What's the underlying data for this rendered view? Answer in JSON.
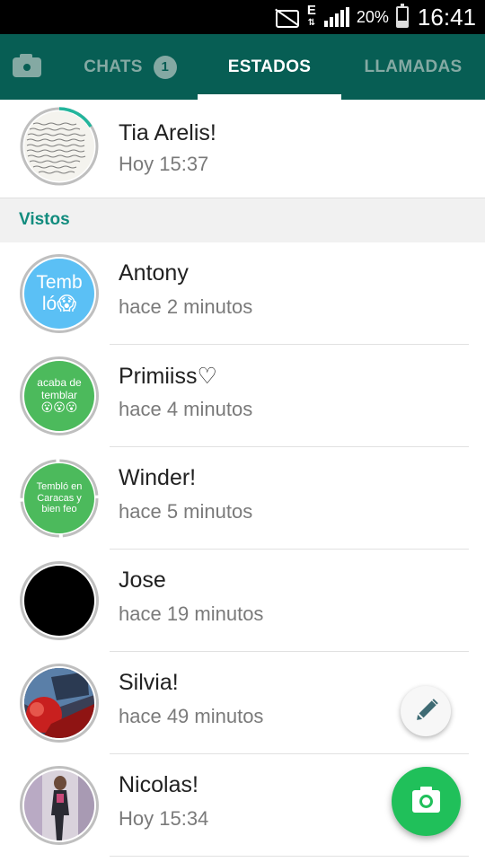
{
  "status_bar": {
    "network_letter": "E",
    "battery_percent": "20%",
    "time": "16:41"
  },
  "tabs": {
    "chats_label": "CHATS",
    "chats_badge": "1",
    "estados_label": "ESTADOS",
    "llamadas_label": "LLAMADAS",
    "active_tab": "ESTADOS"
  },
  "my_update": {
    "name": "Tia Arelis!",
    "time": "Hoy 15:37"
  },
  "section": {
    "label": "Vistos"
  },
  "statuses": [
    {
      "name": "Antony",
      "time": "hace 2 minutos",
      "avatar_line1": "Temb",
      "avatar_line2": "ló😱",
      "avatar_color": "#5bc0f5"
    },
    {
      "name": "Primiiss♡",
      "time": "hace 4 minutos",
      "avatar_line1": "acaba de temblar",
      "avatar_line2": "😮😮😮",
      "avatar_color": "#4cba5c"
    },
    {
      "name": "Winder!",
      "time": "hace 5 minutos",
      "avatar_line1": "Tembló en Caracas y bien feo",
      "avatar_line2": "",
      "avatar_color": "#4cba5c"
    },
    {
      "name": "Jose",
      "time": "hace 19 minutos",
      "avatar_color": "#000000"
    },
    {
      "name": "Silvia!",
      "time": "hace 49 minutos"
    },
    {
      "name": "Nicolas!",
      "time": "Hoy 15:34"
    }
  ],
  "colors": {
    "toolbar": "#075e54",
    "accent": "#128c7e",
    "fab": "#20c05a"
  },
  "icons": {
    "camera_tab": "camera-icon",
    "fab_pencil": "pencil-icon",
    "fab_camera": "camera-icon"
  }
}
